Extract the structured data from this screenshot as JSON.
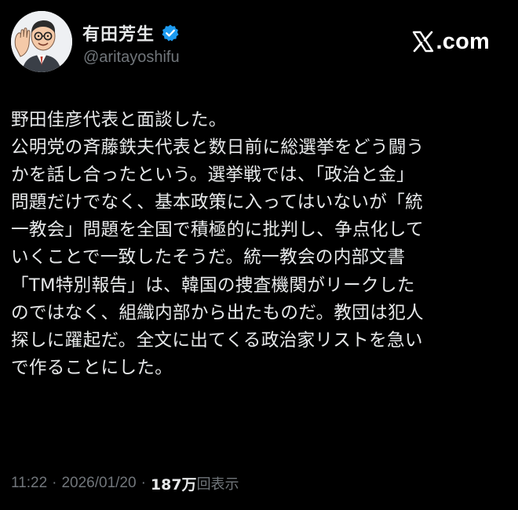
{
  "post": {
    "author": {
      "display_name": "有田芳生",
      "handle": "@aritayoshifu",
      "verified": true,
      "avatar_icon": "caricature-avatar"
    },
    "brand": {
      "icon": "x-logo-icon",
      "domain": ".com"
    },
    "text_lines": [
      "野田佳彦代表と面談した。",
      "公明党の斉藤鉄夫代表と数日前に総選挙をどう闘う",
      "かを話し合ったという。選挙戦では、「政治と金」",
      "問題だけでなく、基本政策に入ってはいないが「統",
      "一教会」問題を全国で積極的に批判し、争点化して",
      "いくことで一致したそうだ。統一教会の内部文書",
      "「TM特別報告」は、韓国の捜査機関がリークした",
      "のではなく、組織内部から出たものだ。教団は犯人",
      "探しに躍起だ。全文に出てくる政治家リストを急い",
      "で作ることにした。"
    ],
    "meta": {
      "time": "11:22",
      "separator": "·",
      "date": "2026/01/20",
      "views_count": "187万",
      "views_label": "回表示"
    }
  },
  "colors": {
    "background": "#000000",
    "text": "#e7e9ea",
    "secondary_text": "#71767b",
    "verified_badge": "#1d9bf0"
  }
}
